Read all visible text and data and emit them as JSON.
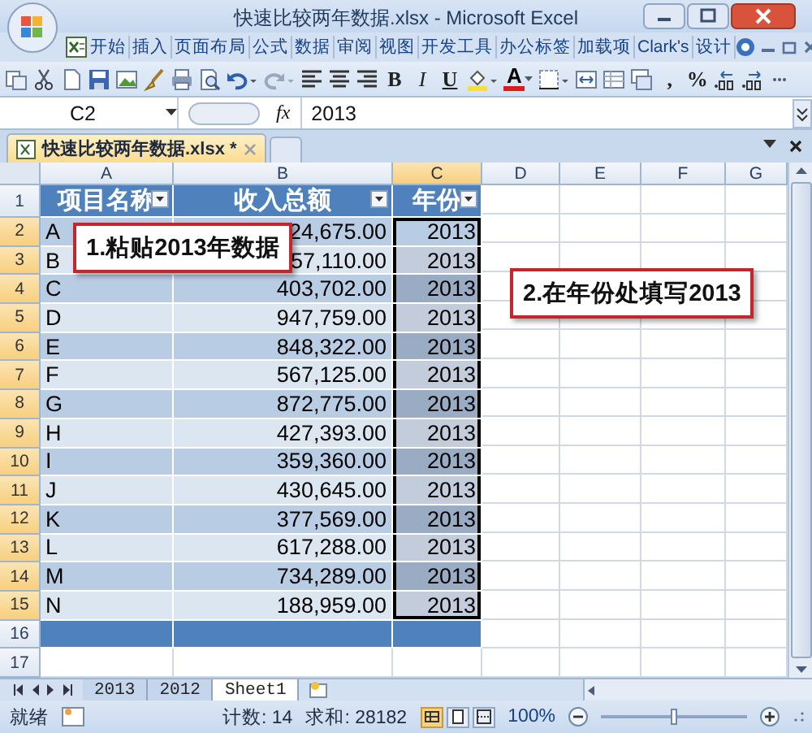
{
  "window": {
    "title": "快速比较两年数据.xlsx - Microsoft Excel"
  },
  "ribbon_tabs": [
    "开始",
    "插入",
    "页面布局",
    "公式",
    "数据",
    "审阅",
    "视图",
    "开发工具",
    "办公标签",
    "加载项",
    "Clark's",
    "设计"
  ],
  "toolbar": [
    {
      "kind": "copy"
    },
    {
      "kind": "cut"
    },
    {
      "kind": "page"
    },
    {
      "kind": "save"
    },
    {
      "kind": "image"
    },
    {
      "kind": "brush"
    },
    {
      "kind": "print"
    },
    {
      "kind": "preview"
    },
    {
      "kind": "undo"
    },
    {
      "kind": "redo"
    },
    {
      "kind": "align-left"
    },
    {
      "kind": "align-center"
    },
    {
      "kind": "align-right"
    },
    {
      "kind": "bold",
      "label": "B"
    },
    {
      "kind": "italic",
      "label": "I"
    },
    {
      "kind": "underline",
      "label": "U"
    },
    {
      "kind": "fill"
    },
    {
      "kind": "font-color",
      "label": "A"
    },
    {
      "kind": "border"
    },
    {
      "kind": "merge"
    },
    {
      "kind": "table"
    },
    {
      "kind": "format"
    },
    {
      "kind": "glyph",
      "label": ","
    },
    {
      "kind": "glyph",
      "label": "%"
    },
    {
      "kind": "decimal-up"
    },
    {
      "kind": "decimal-down"
    },
    {
      "kind": "more"
    }
  ],
  "name_box": "C2",
  "formula_label": "fx",
  "formula": "2013",
  "document_tabs": [
    {
      "label": "快速比较两年数据.xlsx *",
      "selected": true
    }
  ],
  "column_headers": [
    {
      "label": "A",
      "selected": false
    },
    {
      "label": "B",
      "selected": false
    },
    {
      "label": "C",
      "selected": true
    },
    {
      "label": "D",
      "selected": false
    },
    {
      "label": "E",
      "selected": false
    },
    {
      "label": "F",
      "selected": false
    },
    {
      "label": "G",
      "selected": false
    }
  ],
  "row_headers": [
    {
      "label": "1",
      "selected": false
    },
    {
      "label": "2",
      "selected": true
    },
    {
      "label": "3",
      "selected": true
    },
    {
      "label": "4",
      "selected": true
    },
    {
      "label": "5",
      "selected": true
    },
    {
      "label": "6",
      "selected": true
    },
    {
      "label": "7",
      "selected": true
    },
    {
      "label": "8",
      "selected": true
    },
    {
      "label": "9",
      "selected": true
    },
    {
      "label": "10",
      "selected": true
    },
    {
      "label": "11",
      "selected": true
    },
    {
      "label": "12",
      "selected": true
    },
    {
      "label": "13",
      "selected": true
    },
    {
      "label": "14",
      "selected": true
    },
    {
      "label": "15",
      "selected": true
    },
    {
      "label": "16",
      "selected": false
    },
    {
      "label": "17",
      "selected": false
    }
  ],
  "table": {
    "columns": [
      {
        "label": "项目名称"
      },
      {
        "label": "收入总额"
      },
      {
        "label": "年份"
      }
    ],
    "rows": [
      {
        "cells": [
          "A",
          "24,675.00",
          "2013"
        ]
      },
      {
        "cells": [
          "B",
          "57,110.00",
          "2013"
        ]
      },
      {
        "cells": [
          "C",
          "403,702.00",
          "2013"
        ]
      },
      {
        "cells": [
          "D",
          "947,759.00",
          "2013"
        ]
      },
      {
        "cells": [
          "E",
          "848,322.00",
          "2013"
        ]
      },
      {
        "cells": [
          "F",
          "567,125.00",
          "2013"
        ]
      },
      {
        "cells": [
          "G",
          "872,775.00",
          "2013"
        ]
      },
      {
        "cells": [
          "H",
          "427,393.00",
          "2013"
        ]
      },
      {
        "cells": [
          "I",
          "359,360.00",
          "2013"
        ]
      },
      {
        "cells": [
          "J",
          "430,645.00",
          "2013"
        ]
      },
      {
        "cells": [
          "K",
          "377,569.00",
          "2013"
        ]
      },
      {
        "cells": [
          "L",
          "617,288.00",
          "2013"
        ]
      },
      {
        "cells": [
          "M",
          "734,289.00",
          "2013"
        ]
      },
      {
        "cells": [
          "N",
          "188,959.00",
          "2013"
        ]
      }
    ]
  },
  "callouts": [
    {
      "text": "1.粘贴2013年数据"
    },
    {
      "text": "2.在年份处填写2013"
    }
  ],
  "sheet_tabs": [
    {
      "label": "2013",
      "selected": false
    },
    {
      "label": "2012",
      "selected": false
    },
    {
      "label": "Sheet1",
      "selected": true
    }
  ],
  "status_bar": {
    "mode": "就绪",
    "count": "计数: 14",
    "sum": "求和: 28182",
    "view_buttons": [
      {
        "selected": true
      },
      {
        "selected": false
      },
      {
        "selected": false
      }
    ],
    "zoom": "100%",
    "zoom_slider": {
      "level": 0.5
    }
  }
}
